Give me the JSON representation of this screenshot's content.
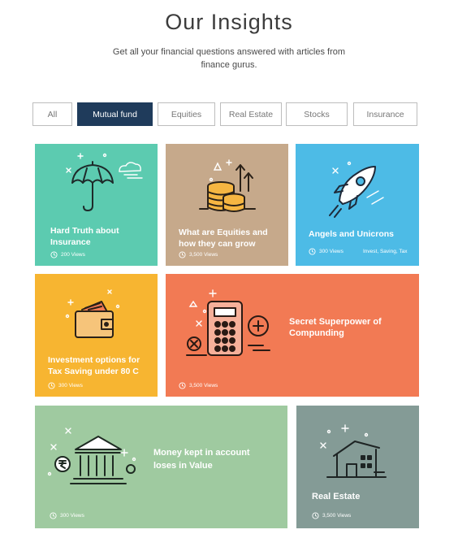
{
  "header": {
    "title": "Our Insights",
    "subtitle": "Get all your financial questions answered with articles from finance gurus."
  },
  "tabs": [
    "All",
    "Mutual fund",
    "Equities",
    "Real Estate",
    "Stocks",
    "Insurance"
  ],
  "active_tab": "Mutual fund",
  "colors": {
    "active_tab": "#1f3b5b",
    "teal": "#5ccbb0",
    "tan": "#c6a98b",
    "sky": "#4dbbe6",
    "yellow": "#f7b531",
    "orange": "#f27a54",
    "green": "#9fcaa0",
    "slate": "#849b96"
  },
  "cards": [
    {
      "title": "Hard Truth about Insurance",
      "views": "200 Views",
      "icon": "umbrella-icon"
    },
    {
      "title": "What are Equities and how they can grow",
      "views": "3,500 Views",
      "icon": "coins-growth-icon"
    },
    {
      "title": "Angels and Unicrons",
      "views": "300 Views",
      "tags": "Invest,  Saving,  Tax",
      "icon": "rocket-icon"
    },
    {
      "title": "Investment options for Tax Saving under 80 C",
      "views": "300 Views",
      "icon": "wallet-icon"
    },
    {
      "title": "Secret Superpower of Compunding",
      "views": "3,500 Views",
      "icon": "calculator-icon"
    },
    {
      "title": "Money kept in account loses in Value",
      "views": "300 Views",
      "icon": "bank-icon"
    },
    {
      "title": "Real Estate",
      "views": "3,500 Views",
      "icon": "house-icon"
    }
  ]
}
